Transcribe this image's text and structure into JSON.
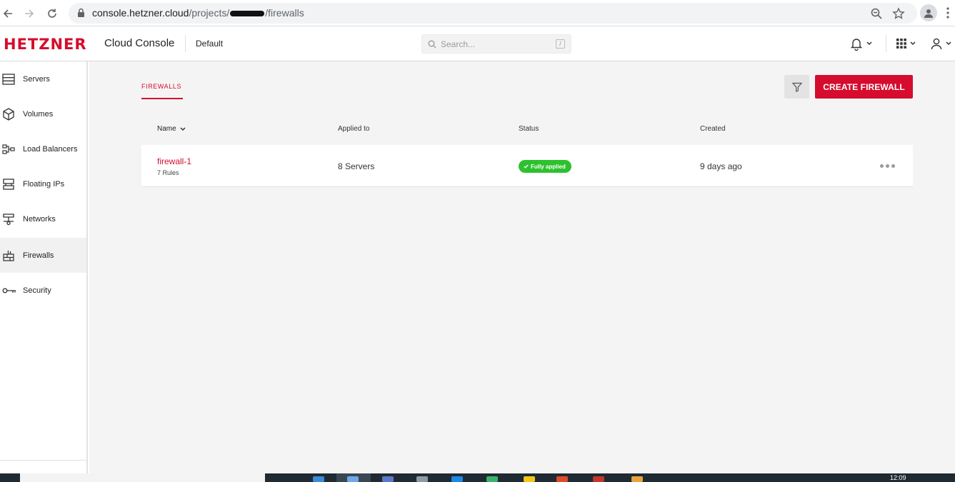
{
  "browser": {
    "url_host": "console.hetzner.cloud",
    "url_path_prefix": "/projects/",
    "url_path_suffix": "/firewalls"
  },
  "header": {
    "logo": "HETZNER",
    "app_title": "Cloud Console",
    "project": "Default",
    "search_placeholder": "Search...",
    "search_shortcut": "/"
  },
  "sidebar": {
    "items": [
      {
        "label": "Servers",
        "icon": "servers-icon"
      },
      {
        "label": "Volumes",
        "icon": "volumes-icon"
      },
      {
        "label": "Load Balancers",
        "icon": "load-balancers-icon"
      },
      {
        "label": "Floating IPs",
        "icon": "floating-ips-icon"
      },
      {
        "label": "Networks",
        "icon": "networks-icon"
      },
      {
        "label": "Firewalls",
        "icon": "firewalls-icon",
        "active": true
      },
      {
        "label": "Security",
        "icon": "key-icon"
      }
    ]
  },
  "main": {
    "tab_label": "FIREWALLS",
    "create_button": "CREATE FIREWALL",
    "columns": {
      "name": "Name",
      "applied_to": "Applied to",
      "status": "Status",
      "created": "Created"
    },
    "rows": [
      {
        "name": "firewall-1",
        "rules": "7 Rules",
        "applied_to": "8 Servers",
        "status": "Fully applied",
        "created": "9 days ago"
      }
    ]
  },
  "taskbar": {
    "clock": "12:09"
  },
  "colors": {
    "brand": "#d50c2d",
    "status_ok": "#2ec12e"
  }
}
